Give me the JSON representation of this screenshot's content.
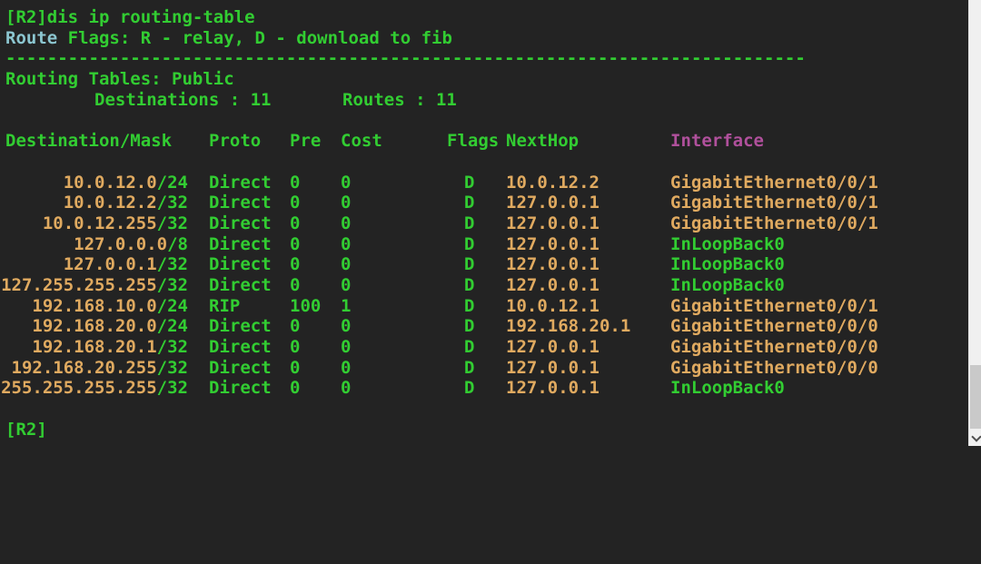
{
  "colors": {
    "background": "#232323",
    "green": "#32cd32",
    "orange": "#e0aa60",
    "cyan": "#8cc6d0",
    "magenta": "#b0509c",
    "scrollbar_track": "#f0f0f0",
    "scrollbar_thumb": "#c9c9c9"
  },
  "terminal": {
    "command_line": "[R2]dis ip routing-table",
    "route_flags": {
      "word": "Route",
      "legend": " Flags: R - relay, D - download to fib"
    },
    "separator": "-----------------------------------------------------------------------------",
    "routing_tables_line": "Routing Tables: Public",
    "destinations_label": "Destinations : 11",
    "routes_label": "Routes : 11",
    "prompt": "[R2]"
  },
  "table": {
    "headers": {
      "destination_mask": "Destination/Mask",
      "proto": "Proto",
      "pre": "Pre",
      "cost": "Cost",
      "flags": "Flags",
      "nexthop": "NextHop",
      "interface": "Interface"
    },
    "rows": [
      {
        "dest_ip": "10.0.12.0",
        "dest_mask": "/24",
        "proto": "Direct",
        "pre": "0",
        "cost": "0",
        "flags": "D",
        "nexthop": "10.0.12.2",
        "interface": "GigabitEthernet0/0/1",
        "interface_color": "#e0aa60"
      },
      {
        "dest_ip": "10.0.12.2",
        "dest_mask": "/32",
        "proto": "Direct",
        "pre": "0",
        "cost": "0",
        "flags": "D",
        "nexthop": "127.0.0.1",
        "interface": "GigabitEthernet0/0/1",
        "interface_color": "#e0aa60"
      },
      {
        "dest_ip": "10.0.12.255",
        "dest_mask": "/32",
        "proto": "Direct",
        "pre": "0",
        "cost": "0",
        "flags": "D",
        "nexthop": "127.0.0.1",
        "interface": "GigabitEthernet0/0/1",
        "interface_color": "#e0aa60"
      },
      {
        "dest_ip": "127.0.0.0",
        "dest_mask": "/8",
        "proto": "Direct",
        "pre": "0",
        "cost": "0",
        "flags": "D",
        "nexthop": "127.0.0.1",
        "interface": "InLoopBack0",
        "interface_color": "#32cd32"
      },
      {
        "dest_ip": "127.0.0.1",
        "dest_mask": "/32",
        "proto": "Direct",
        "pre": "0",
        "cost": "0",
        "flags": "D",
        "nexthop": "127.0.0.1",
        "interface": "InLoopBack0",
        "interface_color": "#32cd32"
      },
      {
        "dest_ip": "127.255.255.255",
        "dest_mask": "/32",
        "proto": "Direct",
        "pre": "0",
        "cost": "0",
        "flags": "D",
        "nexthop": "127.0.0.1",
        "interface": "InLoopBack0",
        "interface_color": "#32cd32"
      },
      {
        "dest_ip": "192.168.10.0",
        "dest_mask": "/24",
        "proto": "RIP",
        "pre": "100",
        "cost": "1",
        "flags": "D",
        "nexthop": "10.0.12.1",
        "interface": "GigabitEthernet0/0/1",
        "interface_color": "#e0aa60"
      },
      {
        "dest_ip": "192.168.20.0",
        "dest_mask": "/24",
        "proto": "Direct",
        "pre": "0",
        "cost": "0",
        "flags": "D",
        "nexthop": "192.168.20.1",
        "interface": "GigabitEthernet0/0/0",
        "interface_color": "#e0aa60"
      },
      {
        "dest_ip": "192.168.20.1",
        "dest_mask": "/32",
        "proto": "Direct",
        "pre": "0",
        "cost": "0",
        "flags": "D",
        "nexthop": "127.0.0.1",
        "interface": "GigabitEthernet0/0/0",
        "interface_color": "#e0aa60"
      },
      {
        "dest_ip": "192.168.20.255",
        "dest_mask": "/32",
        "proto": "Direct",
        "pre": "0",
        "cost": "0",
        "flags": "D",
        "nexthop": "127.0.0.1",
        "interface": "GigabitEthernet0/0/0",
        "interface_color": "#e0aa60"
      },
      {
        "dest_ip": "255.255.255.255",
        "dest_mask": "/32",
        "proto": "Direct",
        "pre": "0",
        "cost": "0",
        "flags": "D",
        "nexthop": "127.0.0.1",
        "interface": "InLoopBack0",
        "interface_color": "#32cd32"
      }
    ]
  }
}
